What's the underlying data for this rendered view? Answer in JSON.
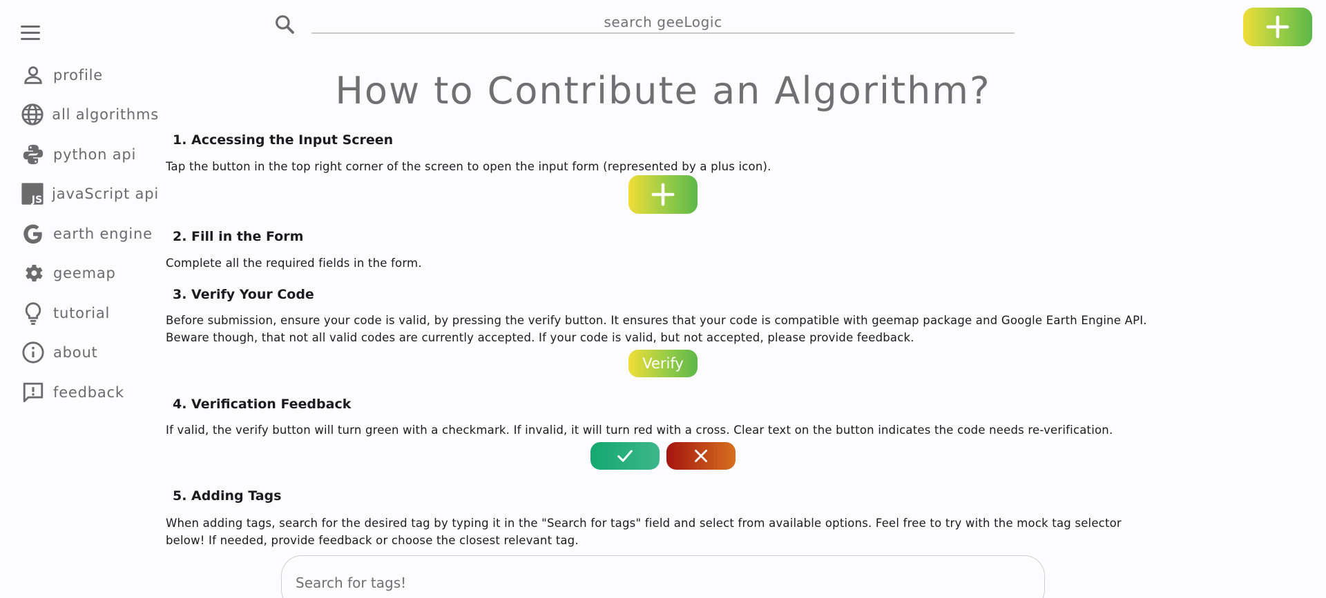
{
  "search": {
    "placeholder": "search geeLogic"
  },
  "sidebar": {
    "items": [
      {
        "label": "profile",
        "icon": "person-icon"
      },
      {
        "label": "all algorithms",
        "icon": "globe-icon"
      },
      {
        "label": "python api",
        "icon": "python-icon"
      },
      {
        "label": "javaScript api",
        "icon": "javascript-icon"
      },
      {
        "label": "earth engine",
        "icon": "google-icon"
      },
      {
        "label": "geemap",
        "icon": "gear-icon"
      },
      {
        "label": "tutorial",
        "icon": "lightbulb-icon"
      },
      {
        "label": "about",
        "icon": "info-icon"
      },
      {
        "label": "feedback",
        "icon": "feedback-icon"
      }
    ]
  },
  "main": {
    "title": "How to Contribute an Algorithm?",
    "sections": [
      {
        "heading": "1. Accessing the Input Screen",
        "text": "Tap the button in the top right corner of the screen to open the input form (represented by a plus icon)."
      },
      {
        "heading": "2. Fill in the Form",
        "text": "Complete all the required fields in the form."
      },
      {
        "heading": "3. Verify Your Code",
        "text": "Before submission, ensure your code is valid, by pressing the verify button. It ensures that your code is compatible with geemap package and Google Earth Engine API. Beware though, that not all valid codes are currently accepted. If your code is valid, but not accepted, please provide feedback."
      },
      {
        "heading": "4. Verification Feedback",
        "text": "If valid, the verify button will turn green with a checkmark. If invalid, it will turn red with a cross. Clear text on the button indicates the code needs re-verification."
      },
      {
        "heading": "5. Adding Tags",
        "text": "When adding tags, search for the desired tag by typing it in the \"Search for tags\" field and select from available options. Feel free to try with the mock tag selector below! If needed, provide feedback or choose the closest relevant tag."
      }
    ],
    "verify_label": "Verify",
    "tag_search": {
      "placeholder": "Search for tags!"
    }
  },
  "colors": {
    "accent_gradient_start": "#f0de38",
    "accent_gradient_end": "#5cb848",
    "success_start": "#14a870",
    "error_start": "#a5150f",
    "error_end": "#d6701f",
    "muted_text": "#6b6b6b"
  }
}
